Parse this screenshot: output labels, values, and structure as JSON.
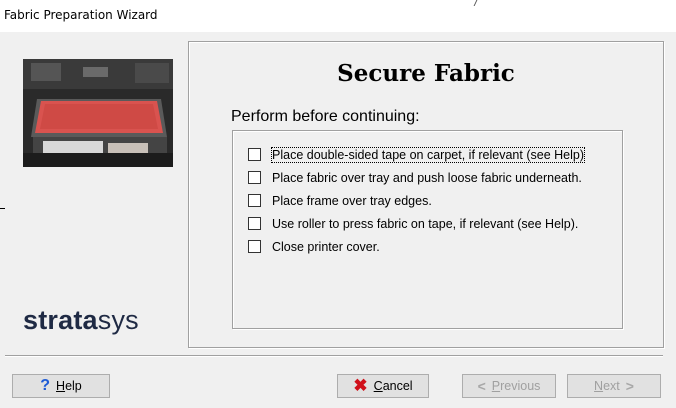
{
  "window": {
    "title": "Fabric Preparation Wizard"
  },
  "sidebar": {
    "logo_bold": "strata",
    "logo_light": "sys",
    "photo_icon": "printer-tray-photo"
  },
  "main": {
    "heading": "Secure Fabric",
    "subheading": "Perform before continuing:",
    "tasks": [
      {
        "label": "Place double-sided tape on carpet, if relevant (see Help)",
        "checked": false
      },
      {
        "label": "Place fabric over tray and push loose fabric underneath.",
        "checked": false
      },
      {
        "label": "Place frame over tray edges.",
        "checked": false
      },
      {
        "label": "Use roller to press fabric on tape, if relevant (see Help).",
        "checked": false
      },
      {
        "label": "Close printer cover.",
        "checked": false
      }
    ]
  },
  "buttons": {
    "help": {
      "mnemonic": "H",
      "rest": "elp",
      "icon": "help-question-icon",
      "enabled": true
    },
    "cancel": {
      "mnemonic": "C",
      "rest": "ancel",
      "icon": "cancel-x-icon",
      "enabled": true
    },
    "previous": {
      "mnemonic": "P",
      "rest": "revious",
      "icon": "left-arrow-icon",
      "enabled": false
    },
    "next": {
      "mnemonic": "N",
      "rest": "ext",
      "icon": "right-arrow-icon",
      "enabled": false
    }
  },
  "colors": {
    "help_icon": "#1e5bd6",
    "cancel_icon": "#d0101a",
    "logo": "#1f2a44",
    "disabled_text": "#a0a0a0"
  }
}
